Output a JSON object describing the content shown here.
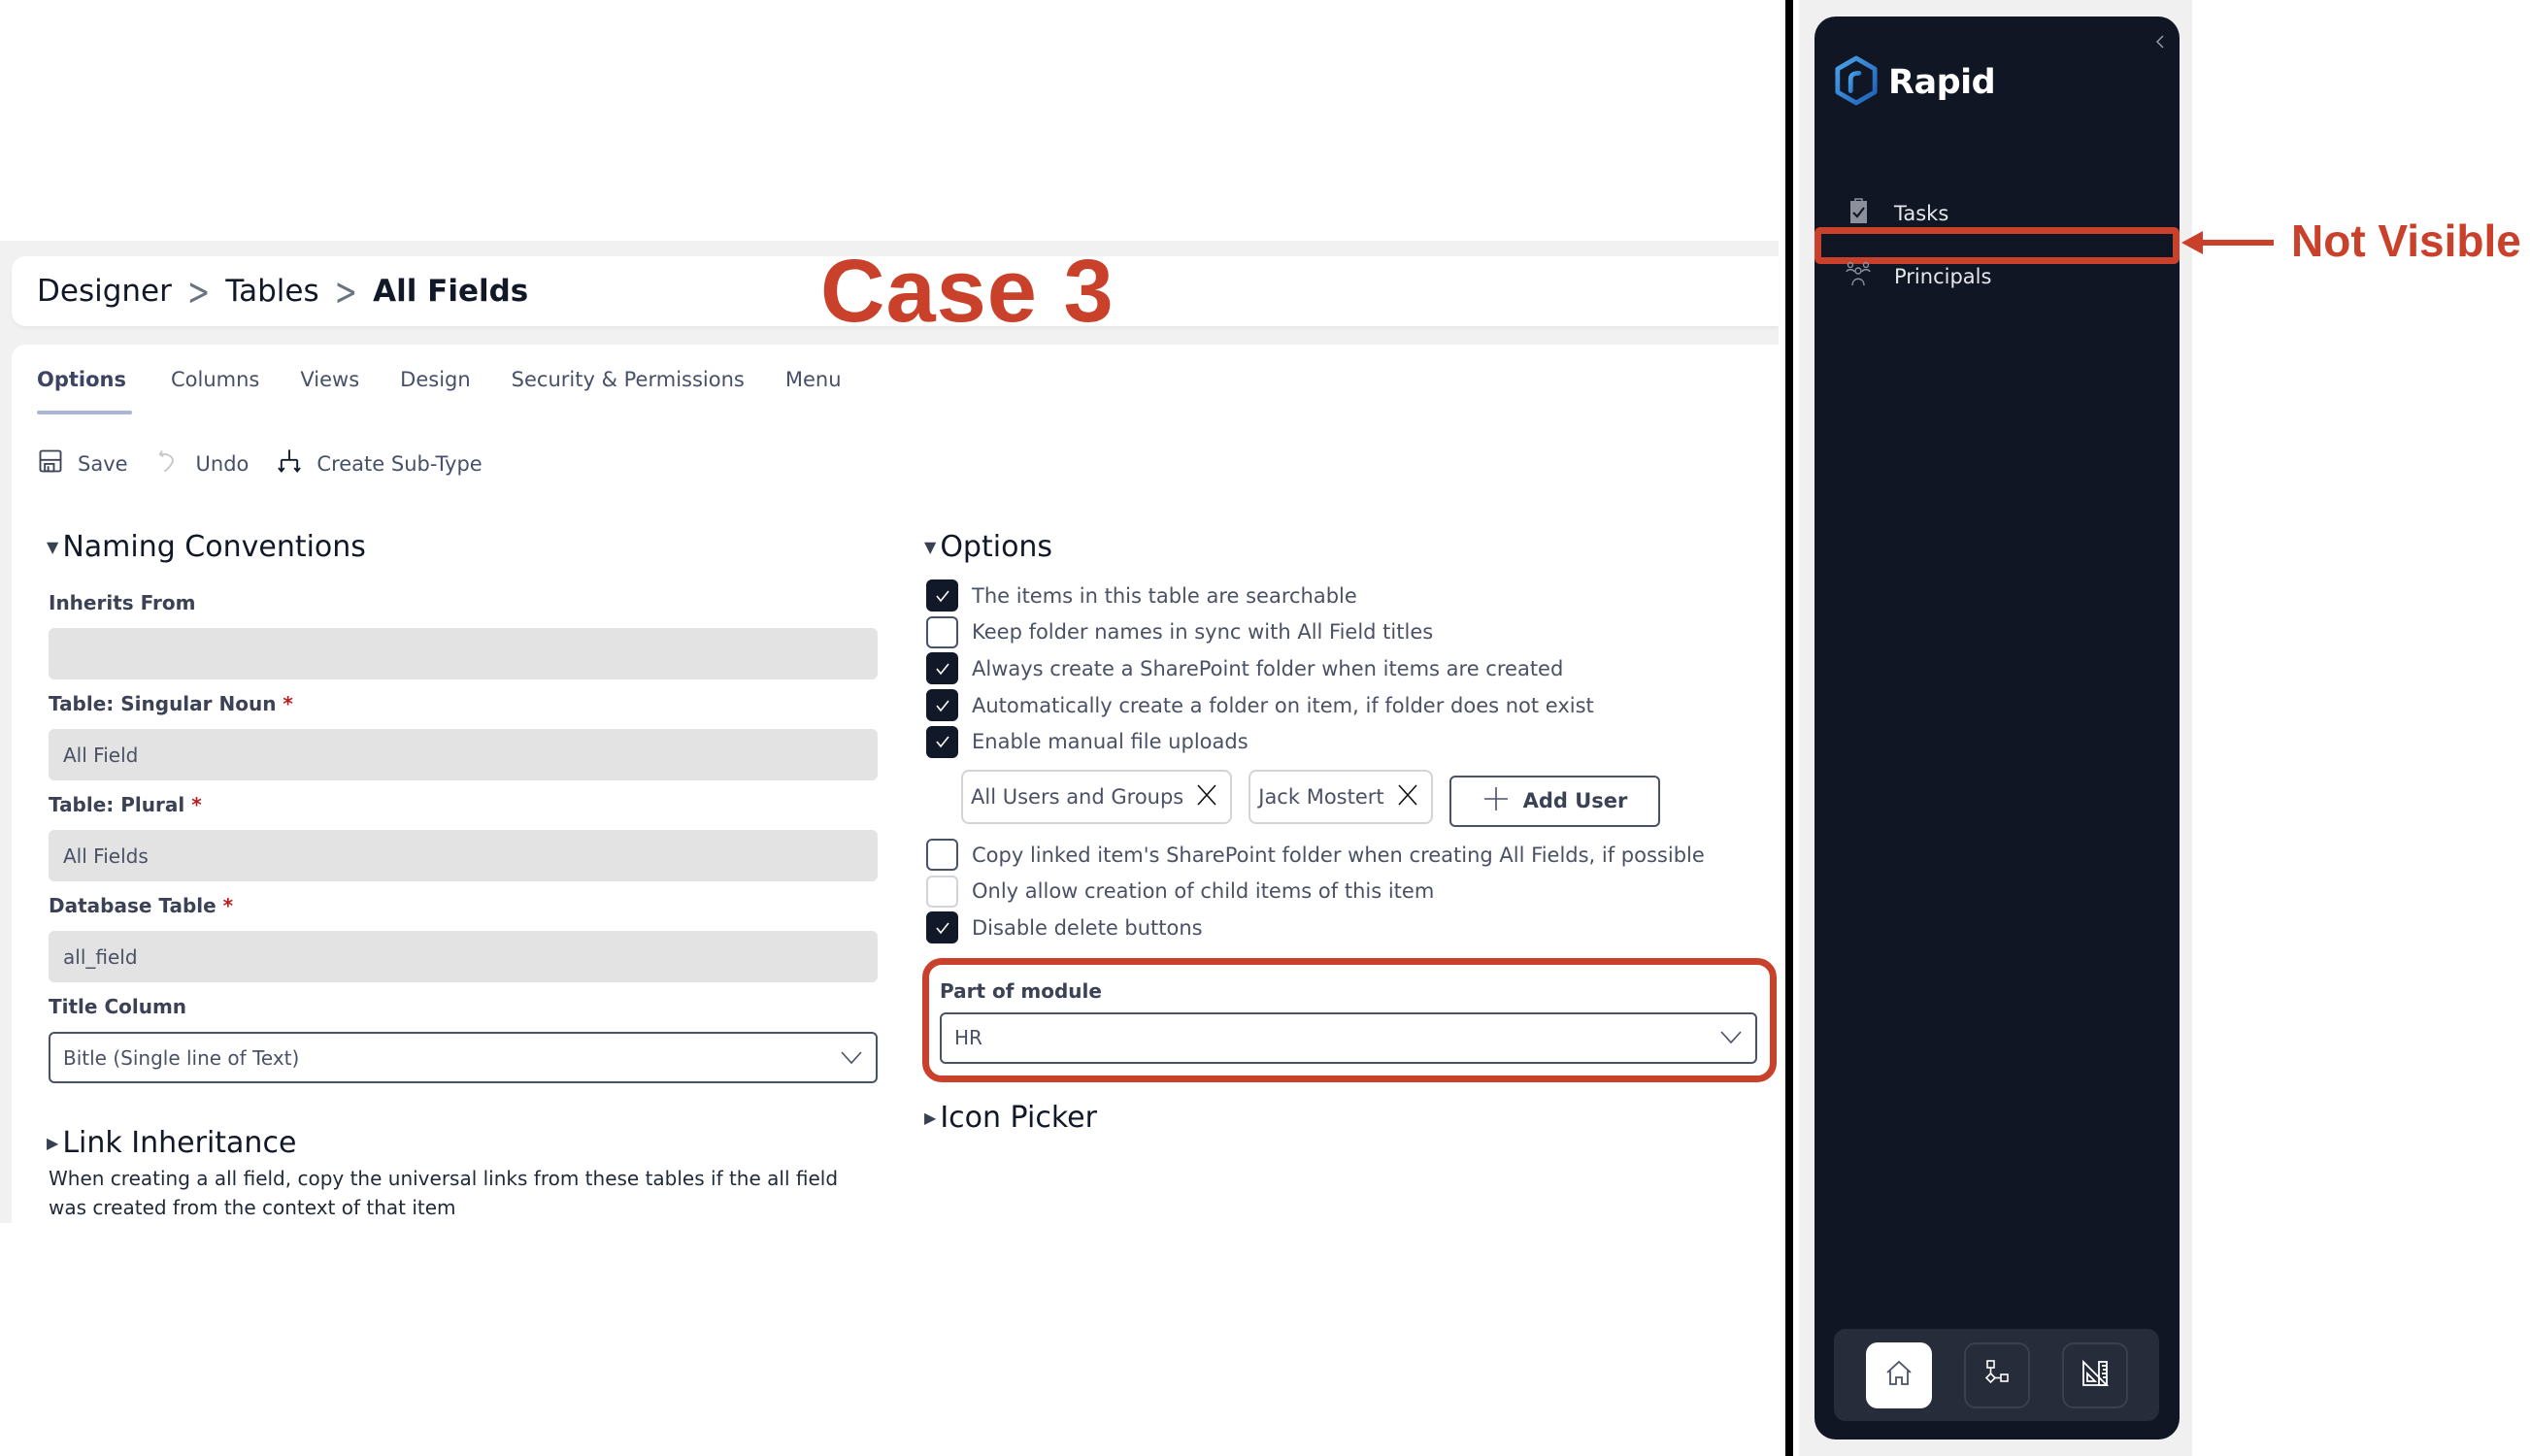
{
  "annotations": {
    "case_label": "Case 3",
    "not_visible_label": "Not Visible",
    "highlight_color": "#c9402b"
  },
  "breadcrumb": {
    "items": [
      "Designer",
      "Tables"
    ],
    "current": "All Fields",
    "separator": ">"
  },
  "tabs": [
    {
      "label": "Options",
      "active": true
    },
    {
      "label": "Columns",
      "active": false
    },
    {
      "label": "Views",
      "active": false
    },
    {
      "label": "Design",
      "active": false
    },
    {
      "label": "Security & Permissions",
      "active": false
    },
    {
      "label": "Menu",
      "active": false
    }
  ],
  "toolbar": {
    "save_label": "Save",
    "undo_label": "Undo",
    "create_subtype_label": "Create Sub-Type"
  },
  "naming_conventions": {
    "title": "Naming Conventions",
    "expanded": true,
    "fields": {
      "inherits_from": {
        "label": "Inherits From",
        "value": ""
      },
      "singular_noun": {
        "label": "Table: Singular Noun",
        "required": "*",
        "value": "All Field"
      },
      "plural": {
        "label": "Table: Plural",
        "required": "*",
        "value": "All Fields"
      },
      "database_table": {
        "label": "Database Table",
        "required": "*",
        "value": "all_field"
      },
      "title_column": {
        "label": "Title Column",
        "value": "Bitle (Single line of Text)"
      }
    }
  },
  "link_inheritance": {
    "title": "Link Inheritance",
    "expanded": false,
    "description": "When creating a all field, copy the universal links from these tables if the all field was created from the context of that item"
  },
  "options": {
    "title": "Options",
    "expanded": true,
    "checkboxes": [
      {
        "label": "The items in this table are searchable",
        "checked": true
      },
      {
        "label": "Keep folder names in sync with All Field titles",
        "checked": false
      },
      {
        "label": "Always create a SharePoint folder when items are created",
        "checked": true
      },
      {
        "label": "Automatically create a folder on item, if folder does not exist",
        "checked": true
      },
      {
        "label": "Enable manual file uploads",
        "checked": true
      }
    ],
    "upload_users": [
      "All Users and Groups",
      "Jack Mostert"
    ],
    "add_user_label": "Add User",
    "checkboxes_after": [
      {
        "label": "Copy linked item's SharePoint folder when creating All Fields, if possible",
        "checked": false
      },
      {
        "label": "Only allow creation of child items of this item",
        "checked": false
      },
      {
        "label": "Disable delete buttons",
        "checked": true
      }
    ],
    "part_of_module": {
      "label": "Part of module",
      "value": "HR"
    }
  },
  "icon_picker": {
    "title": "Icon Picker",
    "expanded": false
  },
  "sidebar": {
    "brand": "Rapid",
    "nav_items": [
      {
        "label": "Tasks",
        "icon": "clipboard-check-icon"
      },
      {
        "label": "Principals",
        "icon": "users-icon"
      }
    ],
    "bottom_buttons": [
      {
        "name": "home",
        "icon": "home-icon",
        "active": true
      },
      {
        "name": "workflow",
        "icon": "flowchart-icon",
        "active": false
      },
      {
        "name": "designer",
        "icon": "ruler-triangle-icon",
        "active": false
      }
    ]
  }
}
